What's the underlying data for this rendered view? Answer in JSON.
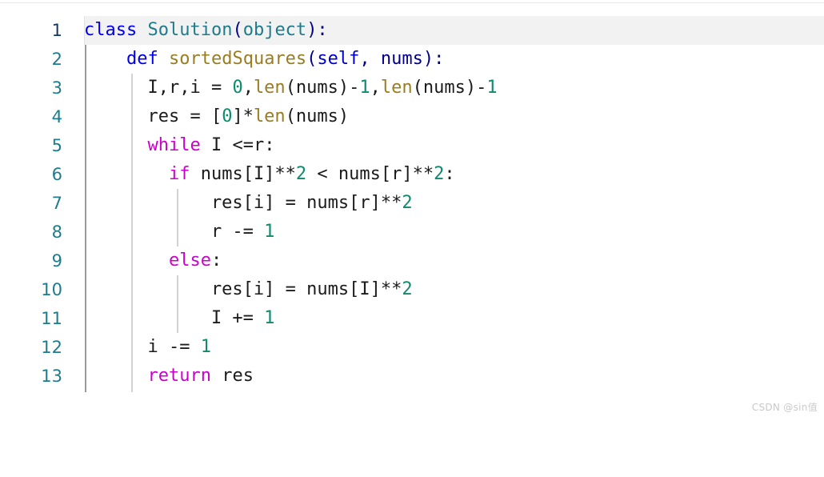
{
  "editor": {
    "language": "python",
    "active_line": 1,
    "total_lines": 13,
    "background_color": "#ffffff",
    "active_line_highlight_color": "#f2f2f2",
    "gutter_color": "#1d7b8c",
    "gutter_active_color": "#14375c"
  },
  "theme_colors": {
    "keyword_declaration": "#0000ee",
    "keyword_control": "#cc00cc",
    "class_name": "#1d7b8c",
    "function_name": "#9a7d20",
    "self_param": "#0000cc",
    "number": "#0e8a6e",
    "punctuation": "#00008b",
    "plain_text": "#1b1b1b",
    "indent_guide": "#d2d2d2",
    "indent_guide_primary": "#9a9a9a"
  },
  "line_numbers": [
    "1",
    "2",
    "3",
    "4",
    "5",
    "6",
    "7",
    "8",
    "9",
    "10",
    "11",
    "12",
    "13"
  ],
  "code_lines": [
    "class Solution(object):",
    "    def sortedSquares(self, nums):",
    "      I,r,i = 0,len(nums)-1,len(nums)-1",
    "      res = [0]*len(nums)",
    "      while I <=r:",
    "        if nums[I]**2 < nums[r]**2:",
    "            res[i] = nums[r]**2",
    "            r -= 1",
    "        else:",
    "            res[i] = nums[I]**2",
    "            I += 1",
    "      i -= 1",
    "      return res"
  ],
  "watermark": {
    "text": "CSDN @sin值"
  }
}
